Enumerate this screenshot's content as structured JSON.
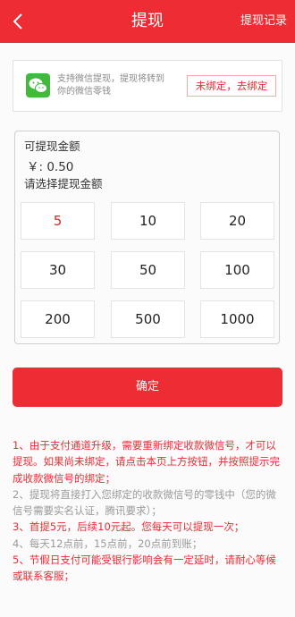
{
  "header": {
    "title": "提现",
    "link_label": "提现记录"
  },
  "wechat": {
    "description": "支持微信提现，提现将转到你的微信零钱",
    "bind_label": "未绑定，去绑定"
  },
  "amount": {
    "label": "可提现金额",
    "balance": "￥: 0.50",
    "select_label": "请选择提现金额",
    "options": [
      "5",
      "10",
      "20",
      "30",
      "50",
      "100",
      "200",
      "500",
      "1000"
    ],
    "selected": "5"
  },
  "confirm_label": "确定",
  "notes": [
    "1、由于支付通道升级，需要重新绑定收款微信号，才可以提现。如果尚未绑定，请点击本页上方按钮，并按照提示完成收款微信号的绑定；",
    "2、提现将直接打入您绑定的收款微信号的零钱中（您的微信号需要实名认证，腾讯要求）；",
    "3、首提5元，后续10元起。您每天可以提现一次；",
    "4、每天12点前，15点前，20点前到账；",
    "5、节假日支付可能受银行影响会有一定延时，请耐心等候或联系客服；"
  ],
  "colors": {
    "accent": "#ee2c34",
    "wechat_green": "#40b93c",
    "note_gray": "#9a9a9a"
  }
}
